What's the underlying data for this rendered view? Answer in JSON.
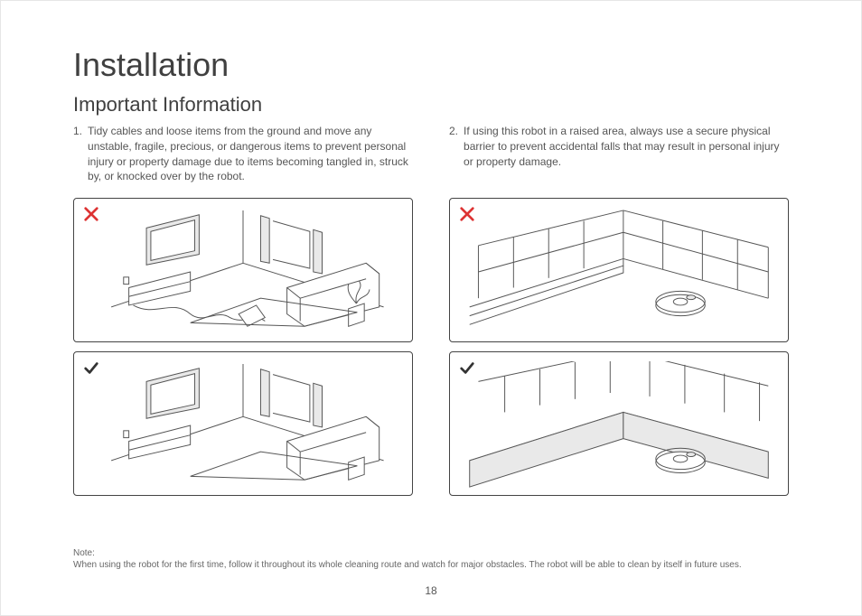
{
  "title": "Installation",
  "subtitle": "Important Information",
  "instructions": [
    {
      "number": "1.",
      "text": "Tidy cables and loose items from the ground and move any unstable, fragile, precious, or dangerous items to prevent personal injury or property damage due to items becoming tangled in, struck by, or knocked over by the robot."
    },
    {
      "number": "2.",
      "text": "If using this robot in a raised area, always use a secure physical barrier to prevent accidental falls that may result in personal injury or property damage."
    }
  ],
  "note_label": "Note:",
  "note_text": "When using the robot for the first time, follow it throughout its whole cleaning route and watch for major obstacles. The robot will be able to clean by itself in future uses.",
  "page_number": "18",
  "marks": {
    "wrong": "✕",
    "right": "✓"
  }
}
